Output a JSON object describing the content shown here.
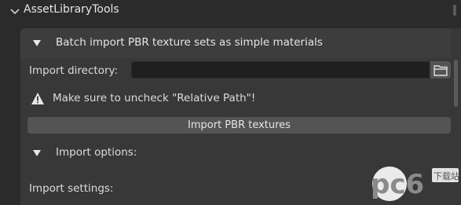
{
  "panel": {
    "title": "AssetLibraryTools"
  },
  "batch_import": {
    "title": "Batch import PBR texture sets as simple materials",
    "import_directory_label": "Import directory:",
    "import_directory_value": "",
    "warning_text": "Make sure to uncheck \"Relative Path\"!",
    "import_button_label": "Import PBR textures"
  },
  "import_options": {
    "title": "Import options:",
    "import_settings_label": "Import settings:"
  },
  "watermark": {
    "text": "pc6",
    "subtext": "下载站"
  },
  "colors": {
    "background": "#2b2b2b",
    "subpanel": "#383838",
    "input": "#1f1f1f",
    "button": "#545454"
  }
}
